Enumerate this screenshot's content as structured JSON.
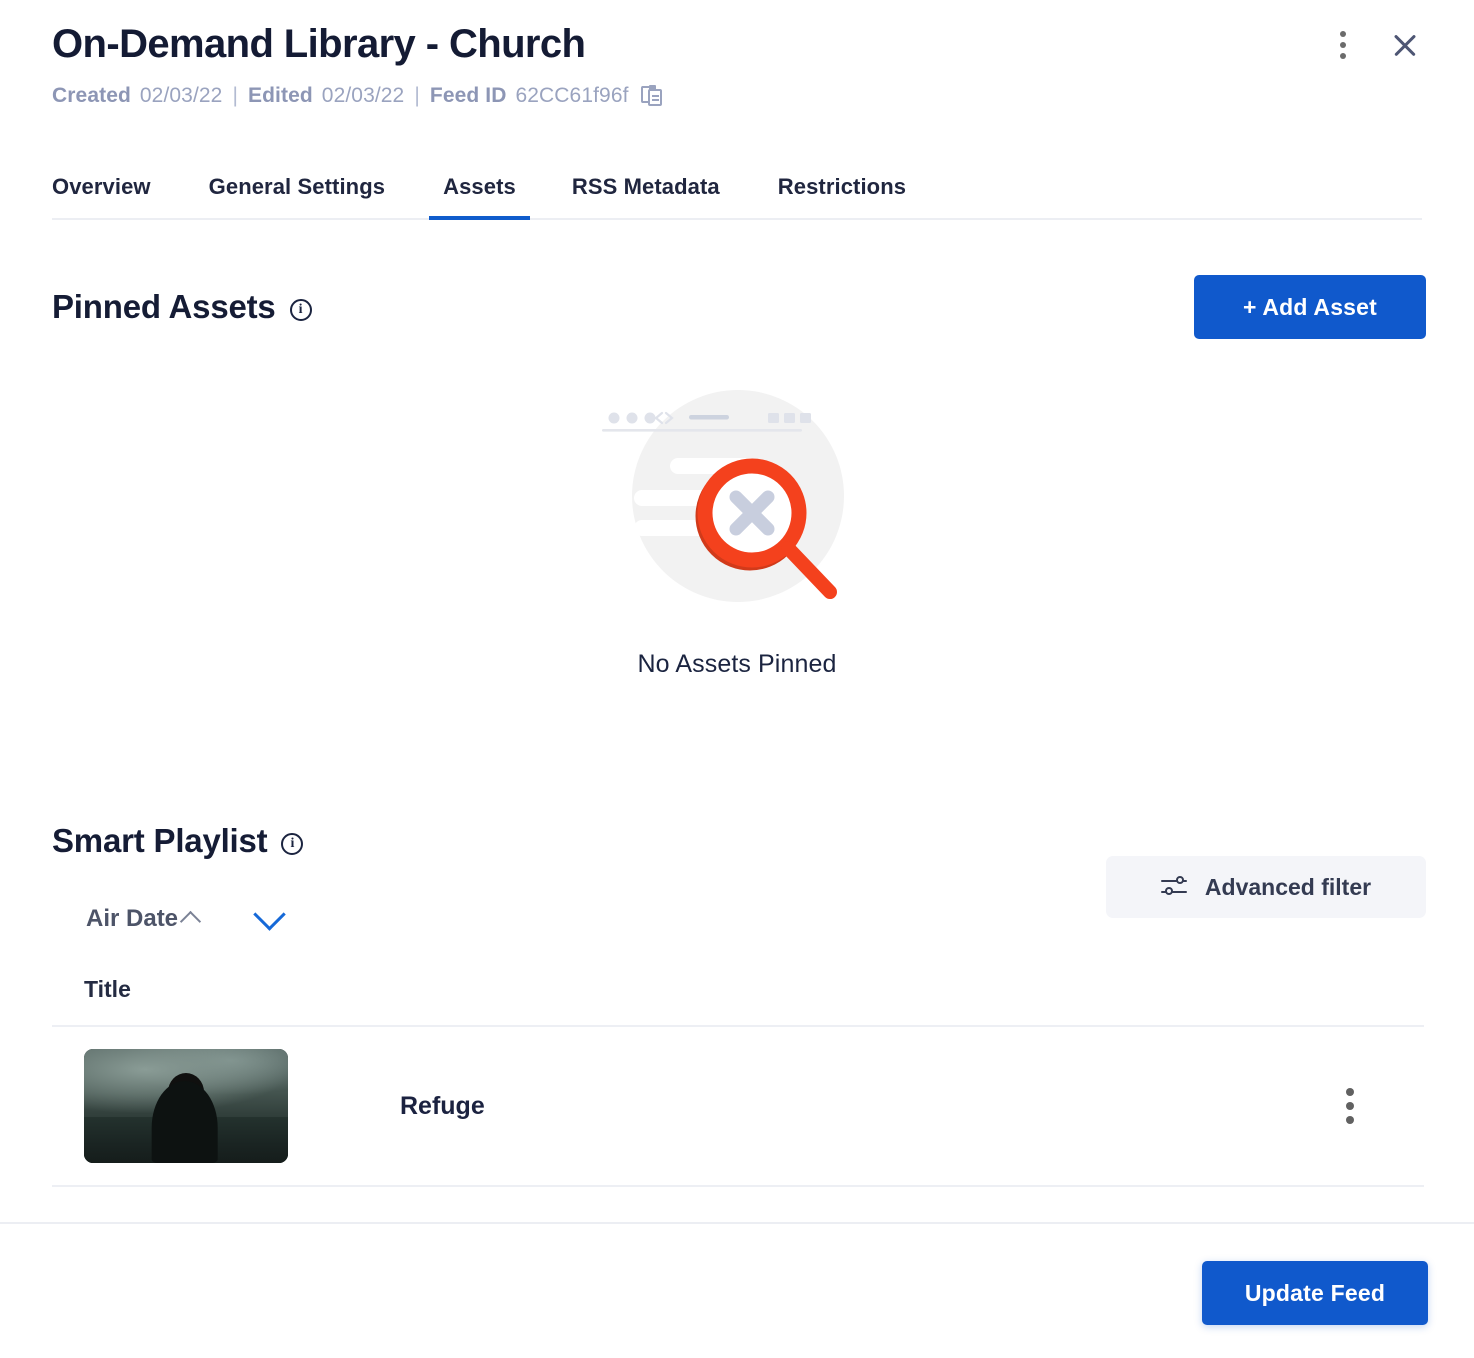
{
  "window": {
    "title": "On-Demand Library - Church",
    "menu_icon": "kebab-menu-icon",
    "close_icon": "close-icon"
  },
  "meta": {
    "created_label": "Created",
    "created_value": "02/03/22",
    "edited_label": "Edited",
    "edited_value": "02/03/22",
    "feed_id_label": "Feed ID",
    "feed_id_value": "62CC61f96f",
    "separator": "|",
    "copy_icon": "copy-to-clipboard-icon"
  },
  "tabs": [
    {
      "label": "Overview",
      "active": false
    },
    {
      "label": "General Settings",
      "active": false
    },
    {
      "label": "Assets",
      "active": true
    },
    {
      "label": "RSS Metadata",
      "active": false
    },
    {
      "label": "Restrictions",
      "active": false
    }
  ],
  "pinned_assets": {
    "heading": "Pinned Assets",
    "info_icon": "info-icon",
    "add_button": "+ Add Asset",
    "empty_text": "No Assets Pinned",
    "empty_illustration": "no-results-magnifier-icon"
  },
  "smart_playlist": {
    "heading": "Smart Playlist",
    "info_icon": "info-icon",
    "advanced_filter_label": "Advanced filter",
    "advanced_filter_icon": "tune-sliders-icon",
    "sort_field": "Air Date",
    "sort_direction_icon": "chevron-up-icon",
    "dropdown_icon": "chevron-down-icon",
    "columns": [
      "Title"
    ],
    "rows": [
      {
        "title": "Refuge",
        "thumbnail": "refuge-thumbnail",
        "row_menu_icon": "kebab-menu-icon"
      }
    ]
  },
  "footer": {
    "update_button": "Update Feed"
  },
  "colors": {
    "primary_blue": "#1059cc",
    "accent_blue": "#1669d8",
    "text_dark": "#1b2240",
    "text_muted": "#9aa3bf",
    "divider": "#eceef3",
    "filter_bg": "#f4f5f9",
    "illustration_red": "#f4411d"
  }
}
